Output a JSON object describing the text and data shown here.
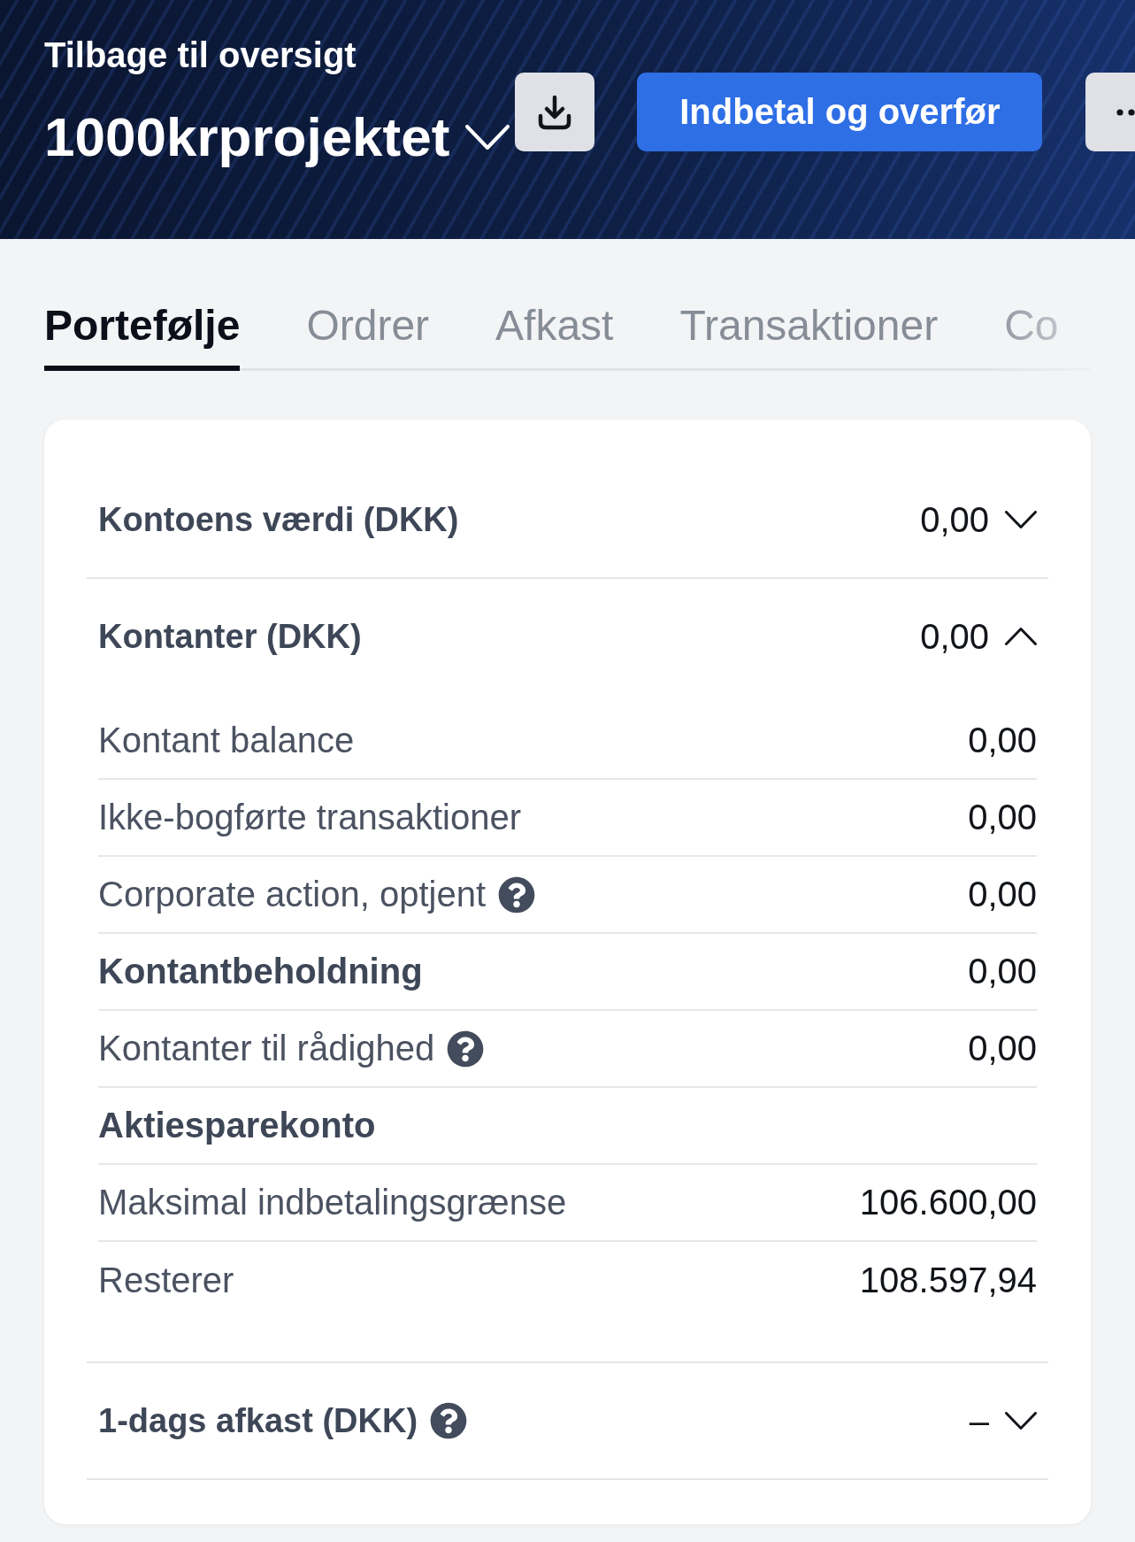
{
  "header": {
    "back_link": "Tilbage til oversigt",
    "account_name": "1000krprojektet",
    "primary_button": "Indbetal og overfør"
  },
  "tabs": [
    {
      "label": "Portefølje",
      "selected": true
    },
    {
      "label": "Ordrer",
      "selected": false
    },
    {
      "label": "Afkast",
      "selected": false
    },
    {
      "label": "Transaktioner",
      "selected": false
    },
    {
      "label": "Co",
      "selected": false
    }
  ],
  "sections": [
    {
      "title": "Kontoens værdi (DKK)",
      "help": false,
      "value": "0,00",
      "expanded": false
    },
    {
      "title": "Kontanter (DKK)",
      "help": false,
      "value": "0,00",
      "expanded": true,
      "rows": [
        {
          "kind": "line",
          "label": "Kontant balance",
          "value": "0,00",
          "help": false
        },
        {
          "kind": "line",
          "label": "Ikke-bogførte transaktioner",
          "value": "0,00",
          "help": false
        },
        {
          "kind": "line",
          "label": "Corporate action, optjent",
          "value": "0,00",
          "help": true
        },
        {
          "kind": "total",
          "label": "Kontantbeholdning",
          "value": "0,00",
          "help": false
        },
        {
          "kind": "line",
          "label": "Kontanter til rådighed",
          "value": "0,00",
          "help": true
        },
        {
          "kind": "heading",
          "label": "Aktiesparekonto",
          "help": false
        },
        {
          "kind": "line",
          "label": "Maksimal indbetalingsgrænse",
          "value": "106.600,00",
          "help": false
        },
        {
          "kind": "line",
          "label": "Resterer",
          "value": "108.597,94",
          "help": false
        }
      ]
    },
    {
      "title": "1-dags afkast (DKK)",
      "help": true,
      "value": "–",
      "expanded": false
    }
  ]
}
